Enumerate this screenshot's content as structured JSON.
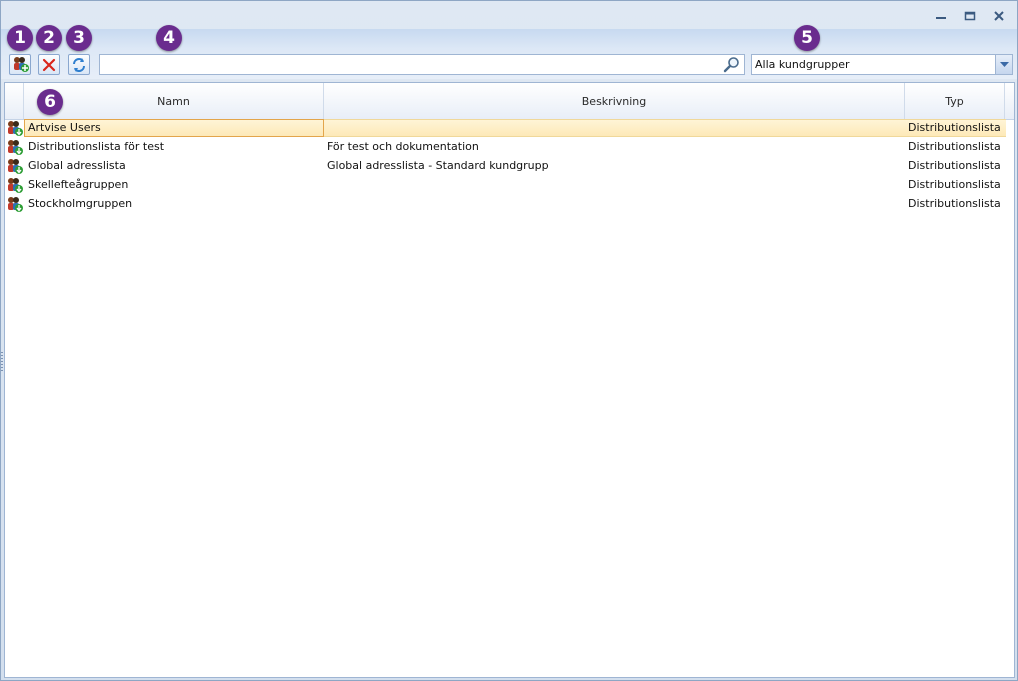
{
  "window": {
    "controls": {
      "minimize_icon": "minimize-icon",
      "restore_icon": "restore-icon",
      "close_icon": "close-icon"
    }
  },
  "toolbar": {
    "new_group_icon": "group-add-icon",
    "delete_icon": "delete-x-icon",
    "refresh_icon": "refresh-icon",
    "search": {
      "value": "",
      "placeholder": "",
      "icon": "search-icon"
    },
    "group_filter": {
      "selected": "Alla kundgrupper"
    }
  },
  "grid": {
    "columns": [
      "Namn",
      "Beskrivning",
      "Typ"
    ],
    "rows": [
      {
        "name": "Artvise Users",
        "description": "",
        "type": "Distributionslista",
        "selected": true
      },
      {
        "name": "Distributionslista för test",
        "description": "För test och dokumentation",
        "type": "Distributionslista"
      },
      {
        "name": "Global adresslista",
        "description": "Global adresslista - Standard kundgrupp",
        "type": "Distributionslista"
      },
      {
        "name": "Skellefteågruppen",
        "description": "",
        "type": "Distributionslista"
      },
      {
        "name": "Stockholmgruppen",
        "description": "",
        "type": "Distributionslista"
      }
    ]
  },
  "callouts": [
    "1",
    "2",
    "3",
    "4",
    "5",
    "6"
  ],
  "colors": {
    "callout": "#6a2c8e",
    "selection": "#fde9b8",
    "selection_border": "#e3a54b"
  }
}
